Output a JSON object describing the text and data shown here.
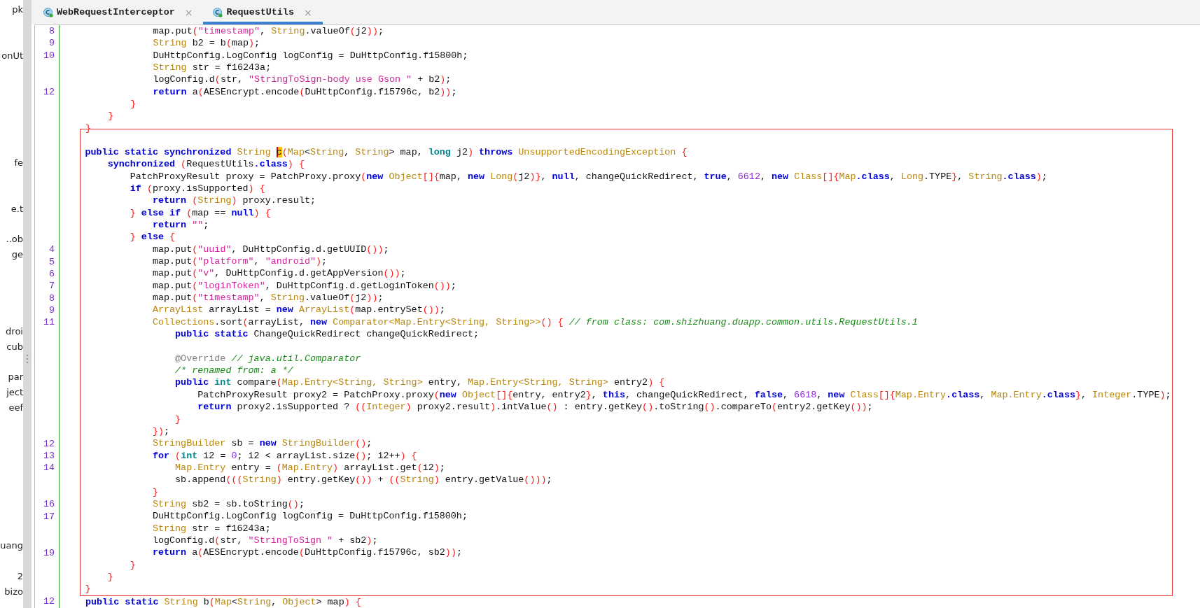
{
  "sidebar": {
    "items": [
      {
        "kind": "label",
        "text": "pk"
      },
      {
        "kind": "gap"
      },
      {
        "kind": "gap"
      },
      {
        "kind": "label",
        "text": "onUt"
      },
      {
        "kind": "gap"
      },
      {
        "kind": "gap"
      },
      {
        "kind": "gap"
      },
      {
        "kind": "gap"
      },
      {
        "kind": "gap"
      },
      {
        "kind": "gap"
      },
      {
        "kind": "label",
        "text": "fe"
      },
      {
        "kind": "gap"
      },
      {
        "kind": "gap"
      },
      {
        "kind": "label",
        "text": "e.t"
      },
      {
        "kind": "gap"
      },
      {
        "kind": "label",
        "text": "..ob"
      },
      {
        "kind": "label",
        "text": "ge"
      },
      {
        "kind": "gap"
      },
      {
        "kind": "gap"
      },
      {
        "kind": "gap"
      },
      {
        "kind": "gap"
      },
      {
        "kind": "label",
        "text": "droi"
      },
      {
        "kind": "label",
        "text": "cub"
      },
      {
        "kind": "gap"
      },
      {
        "kind": "label",
        "text": "par"
      },
      {
        "kind": "label",
        "text": "ject"
      },
      {
        "kind": "label",
        "text": "eef"
      },
      {
        "kind": "gap"
      },
      {
        "kind": "gap"
      },
      {
        "kind": "gap"
      },
      {
        "kind": "gap"
      },
      {
        "kind": "gap"
      },
      {
        "kind": "gap"
      },
      {
        "kind": "gap"
      },
      {
        "kind": "gap"
      },
      {
        "kind": "label",
        "text": "uang"
      },
      {
        "kind": "gap"
      },
      {
        "kind": "label",
        "text": "2"
      },
      {
        "kind": "label",
        "text": "bizo"
      }
    ]
  },
  "tabs": [
    {
      "label": "WebRequestInterceptor",
      "close": "×",
      "selected": false
    },
    {
      "label": "RequestUtils",
      "close": "×",
      "selected": true
    }
  ],
  "editor": {
    "blocks": [
      {
        "framed": false,
        "lines": [
          {
            "kind": "code",
            "number": "8",
            "tokens": [
              {
                "kind": "txt",
                "text": "            map.put"
              },
              {
                "kind": "br",
                "text": "("
              },
              {
                "kind": "str",
                "text": "\"timestamp\""
              },
              {
                "kind": "txt",
                "text": ", "
              },
              {
                "kind": "type",
                "text": "String"
              },
              {
                "kind": "txt",
                "text": ".valueOf"
              },
              {
                "kind": "br",
                "text": "("
              },
              {
                "kind": "txt",
                "text": "j2"
              },
              {
                "kind": "br",
                "text": "))"
              },
              {
                "kind": "txt",
                "text": ";"
              }
            ]
          },
          {
            "kind": "code",
            "number": "9",
            "tokens": [
              {
                "kind": "type",
                "text": "            String"
              },
              {
                "kind": "txt",
                "text": " b2 = b"
              },
              {
                "kind": "br",
                "text": "("
              },
              {
                "kind": "txt",
                "text": "map"
              },
              {
                "kind": "br",
                "text": ")"
              },
              {
                "kind": "txt",
                "text": ";"
              }
            ]
          },
          {
            "kind": "code",
            "number": "10",
            "tokens": [
              {
                "kind": "txt",
                "text": "            DuHttpConfig.LogConfig logConfig = DuHttpConfig.f15800h;"
              }
            ]
          },
          {
            "kind": "code",
            "tokens": [
              {
                "kind": "type",
                "text": "            String"
              },
              {
                "kind": "txt",
                "text": " str = f16243a;"
              }
            ]
          },
          {
            "kind": "code",
            "tokens": [
              {
                "kind": "txt",
                "text": "            logConfig.d"
              },
              {
                "kind": "br",
                "text": "("
              },
              {
                "kind": "txt",
                "text": "str, "
              },
              {
                "kind": "str",
                "text": "\"StringToSign-body use Gson \""
              },
              {
                "kind": "txt",
                "text": " + b2"
              },
              {
                "kind": "br",
                "text": ")"
              },
              {
                "kind": "txt",
                "text": ";"
              }
            ]
          },
          {
            "kind": "code",
            "number": "12",
            "tokens": [
              {
                "kind": "kw",
                "text": "            return"
              },
              {
                "kind": "txt",
                "text": " a"
              },
              {
                "kind": "br",
                "text": "("
              },
              {
                "kind": "txt",
                "text": "AESEncrypt.encode"
              },
              {
                "kind": "br",
                "text": "("
              },
              {
                "kind": "txt",
                "text": "DuHttpConfig.f15796c, b2"
              },
              {
                "kind": "br",
                "text": "))"
              },
              {
                "kind": "txt",
                "text": ";"
              }
            ]
          },
          {
            "kind": "code",
            "tokens": [
              {
                "kind": "br",
                "text": "        }"
              }
            ]
          },
          {
            "kind": "code",
            "tokens": [
              {
                "kind": "br",
                "text": "    }"
              }
            ]
          },
          {
            "kind": "code",
            "tokens": [
              {
                "kind": "br",
                "text": "}"
              }
            ]
          }
        ]
      },
      {
        "framed": true,
        "lines": [
          {
            "kind": "blank"
          },
          {
            "kind": "code",
            "tokens": [
              {
                "kind": "kw",
                "text": "public static synchronized "
              },
              {
                "kind": "type",
                "text": "String "
              },
              {
                "kind": "mark",
                "text": "c"
              },
              {
                "kind": "br",
                "text": "("
              },
              {
                "kind": "type",
                "text": "Map"
              },
              {
                "kind": "txt",
                "text": "<"
              },
              {
                "kind": "type",
                "text": "String"
              },
              {
                "kind": "txt",
                "text": ", "
              },
              {
                "kind": "type",
                "text": "String"
              },
              {
                "kind": "txt",
                "text": "> map, "
              },
              {
                "kind": "prim",
                "text": "long"
              },
              {
                "kind": "txt",
                "text": " j2"
              },
              {
                "kind": "br",
                "text": ") "
              },
              {
                "kind": "kw",
                "text": "throws "
              },
              {
                "kind": "type",
                "text": "UnsupportedEncodingException "
              },
              {
                "kind": "br",
                "text": "{"
              }
            ]
          },
          {
            "kind": "code",
            "tokens": [
              {
                "kind": "kw",
                "text": "    synchronized "
              },
              {
                "kind": "br",
                "text": "("
              },
              {
                "kind": "txt",
                "text": "RequestUtils"
              },
              {
                "kind": "kw",
                "text": ".class"
              },
              {
                "kind": "br",
                "text": ") {"
              }
            ]
          },
          {
            "kind": "code",
            "tokens": [
              {
                "kind": "txt",
                "text": "        PatchProxyResult proxy = PatchProxy.proxy"
              },
              {
                "kind": "br",
                "text": "("
              },
              {
                "kind": "kw",
                "text": "new "
              },
              {
                "kind": "type",
                "text": "Object"
              },
              {
                "kind": "br",
                "text": "[]{"
              },
              {
                "kind": "txt",
                "text": "map, "
              },
              {
                "kind": "kw",
                "text": "new "
              },
              {
                "kind": "type",
                "text": "Long"
              },
              {
                "kind": "br",
                "text": "("
              },
              {
                "kind": "txt",
                "text": "j2"
              },
              {
                "kind": "br",
                "text": ")}"
              },
              {
                "kind": "txt",
                "text": ", "
              },
              {
                "kind": "kw",
                "text": "null"
              },
              {
                "kind": "txt",
                "text": ", changeQuickRedirect, "
              },
              {
                "kind": "kw",
                "text": "true"
              },
              {
                "kind": "txt",
                "text": ", "
              },
              {
                "kind": "num",
                "text": "6612"
              },
              {
                "kind": "txt",
                "text": ", "
              },
              {
                "kind": "kw",
                "text": "new "
              },
              {
                "kind": "type",
                "text": "Class"
              },
              {
                "kind": "br",
                "text": "[]{"
              },
              {
                "kind": "type",
                "text": "Map"
              },
              {
                "kind": "kw",
                "text": ".class"
              },
              {
                "kind": "txt",
                "text": ", "
              },
              {
                "kind": "type",
                "text": "Long"
              },
              {
                "kind": "txt",
                "text": ".TYPE"
              },
              {
                "kind": "br",
                "text": "}"
              },
              {
                "kind": "txt",
                "text": ", "
              },
              {
                "kind": "type",
                "text": "String"
              },
              {
                "kind": "kw",
                "text": ".class"
              },
              {
                "kind": "br",
                "text": ")"
              },
              {
                "kind": "txt",
                "text": ";"
              }
            ]
          },
          {
            "kind": "code",
            "tokens": [
              {
                "kind": "kw",
                "text": "        if "
              },
              {
                "kind": "br",
                "text": "("
              },
              {
                "kind": "txt",
                "text": "proxy.isSupported"
              },
              {
                "kind": "br",
                "text": ") {"
              }
            ]
          },
          {
            "kind": "code",
            "tokens": [
              {
                "kind": "kw",
                "text": "            return "
              },
              {
                "kind": "br",
                "text": "("
              },
              {
                "kind": "type",
                "text": "String"
              },
              {
                "kind": "br",
                "text": ")"
              },
              {
                "kind": "txt",
                "text": " proxy.result;"
              }
            ]
          },
          {
            "kind": "code",
            "tokens": [
              {
                "kind": "br",
                "text": "        } "
              },
              {
                "kind": "kw",
                "text": "else if "
              },
              {
                "kind": "br",
                "text": "("
              },
              {
                "kind": "txt",
                "text": "map == "
              },
              {
                "kind": "kw",
                "text": "null"
              },
              {
                "kind": "br",
                "text": ") {"
              }
            ]
          },
          {
            "kind": "code",
            "tokens": [
              {
                "kind": "kw",
                "text": "            return "
              },
              {
                "kind": "str",
                "text": "\"\""
              },
              {
                "kind": "txt",
                "text": ";"
              }
            ]
          },
          {
            "kind": "code",
            "tokens": [
              {
                "kind": "br",
                "text": "        } "
              },
              {
                "kind": "kw",
                "text": "else "
              },
              {
                "kind": "br",
                "text": "{"
              }
            ]
          },
          {
            "kind": "code",
            "number": "4",
            "tokens": [
              {
                "kind": "txt",
                "text": "            map.put"
              },
              {
                "kind": "br",
                "text": "("
              },
              {
                "kind": "str",
                "text": "\"uuid\""
              },
              {
                "kind": "txt",
                "text": ", DuHttpConfig.d.getUUID"
              },
              {
                "kind": "br",
                "text": "())"
              },
              {
                "kind": "txt",
                "text": ";"
              }
            ]
          },
          {
            "kind": "code",
            "number": "5",
            "tokens": [
              {
                "kind": "txt",
                "text": "            map.put"
              },
              {
                "kind": "br",
                "text": "("
              },
              {
                "kind": "str",
                "text": "\"platform\""
              },
              {
                "kind": "txt",
                "text": ", "
              },
              {
                "kind": "str",
                "text": "\"android\""
              },
              {
                "kind": "br",
                "text": ")"
              },
              {
                "kind": "txt",
                "text": ";"
              }
            ]
          },
          {
            "kind": "code",
            "number": "6",
            "tokens": [
              {
                "kind": "txt",
                "text": "            map.put"
              },
              {
                "kind": "br",
                "text": "("
              },
              {
                "kind": "str",
                "text": "\"v\""
              },
              {
                "kind": "txt",
                "text": ", DuHttpConfig.d.getAppVersion"
              },
              {
                "kind": "br",
                "text": "())"
              },
              {
                "kind": "txt",
                "text": ";"
              }
            ]
          },
          {
            "kind": "code",
            "number": "7",
            "tokens": [
              {
                "kind": "txt",
                "text": "            map.put"
              },
              {
                "kind": "br",
                "text": "("
              },
              {
                "kind": "str",
                "text": "\"loginToken\""
              },
              {
                "kind": "txt",
                "text": ", DuHttpConfig.d.getLoginToken"
              },
              {
                "kind": "br",
                "text": "())"
              },
              {
                "kind": "txt",
                "text": ";"
              }
            ]
          },
          {
            "kind": "code",
            "number": "8",
            "tokens": [
              {
                "kind": "txt",
                "text": "            map.put"
              },
              {
                "kind": "br",
                "text": "("
              },
              {
                "kind": "str",
                "text": "\"timestamp\""
              },
              {
                "kind": "txt",
                "text": ", "
              },
              {
                "kind": "type",
                "text": "String"
              },
              {
                "kind": "txt",
                "text": ".valueOf"
              },
              {
                "kind": "br",
                "text": "("
              },
              {
                "kind": "txt",
                "text": "j2"
              },
              {
                "kind": "br",
                "text": "))"
              },
              {
                "kind": "txt",
                "text": ";"
              }
            ]
          },
          {
            "kind": "code",
            "number": "9",
            "tokens": [
              {
                "kind": "type",
                "text": "            ArrayList"
              },
              {
                "kind": "txt",
                "text": " arrayList = "
              },
              {
                "kind": "kw",
                "text": "new "
              },
              {
                "kind": "type",
                "text": "ArrayList"
              },
              {
                "kind": "br",
                "text": "("
              },
              {
                "kind": "txt",
                "text": "map.entrySet"
              },
              {
                "kind": "br",
                "text": "())"
              },
              {
                "kind": "txt",
                "text": ";"
              }
            ]
          },
          {
            "kind": "code",
            "number": "11",
            "tokens": [
              {
                "kind": "type",
                "text": "            Collections"
              },
              {
                "kind": "txt",
                "text": ".sort"
              },
              {
                "kind": "br",
                "text": "("
              },
              {
                "kind": "txt",
                "text": "arrayList, "
              },
              {
                "kind": "kw",
                "text": "new "
              },
              {
                "kind": "type",
                "text": "Comparator<Map.Entry<String, String>>"
              },
              {
                "kind": "br",
                "text": "() { "
              },
              {
                "kind": "com",
                "text": "// from class: com.shizhuang.duapp.common.utils.RequestUtils.1"
              }
            ]
          },
          {
            "kind": "code",
            "tokens": [
              {
                "kind": "kw",
                "text": "                public static"
              },
              {
                "kind": "txt",
                "text": " ChangeQuickRedirect changeQuickRedirect;"
              }
            ]
          },
          {
            "kind": "blank"
          },
          {
            "kind": "code",
            "tokens": [
              {
                "kind": "ann",
                "text": "                @Override "
              },
              {
                "kind": "com",
                "text": "// java.util.Comparator"
              }
            ]
          },
          {
            "kind": "code",
            "tokens": [
              {
                "kind": "com",
                "text": "                /* renamed from: a */"
              }
            ]
          },
          {
            "kind": "code",
            "tokens": [
              {
                "kind": "kw",
                "text": "                public "
              },
              {
                "kind": "prim",
                "text": "int"
              },
              {
                "kind": "txt",
                "text": " compare"
              },
              {
                "kind": "br",
                "text": "("
              },
              {
                "kind": "type",
                "text": "Map.Entry<String, String>"
              },
              {
                "kind": "txt",
                "text": " entry, "
              },
              {
                "kind": "type",
                "text": "Map.Entry<String, String>"
              },
              {
                "kind": "txt",
                "text": " entry2"
              },
              {
                "kind": "br",
                "text": ") {"
              }
            ]
          },
          {
            "kind": "code",
            "tokens": [
              {
                "kind": "txt",
                "text": "                    PatchProxyResult proxy2 = PatchProxy.proxy"
              },
              {
                "kind": "br",
                "text": "("
              },
              {
                "kind": "kw",
                "text": "new "
              },
              {
                "kind": "type",
                "text": "Object"
              },
              {
                "kind": "br",
                "text": "[]{"
              },
              {
                "kind": "txt",
                "text": "entry, entry2"
              },
              {
                "kind": "br",
                "text": "}"
              },
              {
                "kind": "txt",
                "text": ", "
              },
              {
                "kind": "kw",
                "text": "this"
              },
              {
                "kind": "txt",
                "text": ", changeQuickRedirect, "
              },
              {
                "kind": "kw",
                "text": "false"
              },
              {
                "kind": "txt",
                "text": ", "
              },
              {
                "kind": "num",
                "text": "6618"
              },
              {
                "kind": "txt",
                "text": ", "
              },
              {
                "kind": "kw",
                "text": "new "
              },
              {
                "kind": "type",
                "text": "Class"
              },
              {
                "kind": "br",
                "text": "[]{"
              },
              {
                "kind": "type",
                "text": "Map.Entry"
              },
              {
                "kind": "kw",
                "text": ".class"
              },
              {
                "kind": "txt",
                "text": ", "
              },
              {
                "kind": "type",
                "text": "Map.Entry"
              },
              {
                "kind": "kw",
                "text": ".class"
              },
              {
                "kind": "br",
                "text": "}"
              },
              {
                "kind": "txt",
                "text": ", "
              },
              {
                "kind": "type",
                "text": "Integer"
              },
              {
                "kind": "txt",
                "text": ".TYPE"
              },
              {
                "kind": "br",
                "text": ")"
              },
              {
                "kind": "txt",
                "text": ";"
              }
            ]
          },
          {
            "kind": "code",
            "tokens": [
              {
                "kind": "kw",
                "text": "                    return"
              },
              {
                "kind": "txt",
                "text": " proxy2.isSupported ? "
              },
              {
                "kind": "br",
                "text": "(("
              },
              {
                "kind": "type",
                "text": "Integer"
              },
              {
                "kind": "br",
                "text": ")"
              },
              {
                "kind": "txt",
                "text": " proxy2.result"
              },
              {
                "kind": "br",
                "text": ")"
              },
              {
                "kind": "txt",
                "text": ".intValue"
              },
              {
                "kind": "br",
                "text": "()"
              },
              {
                "kind": "txt",
                "text": " : entry.getKey"
              },
              {
                "kind": "br",
                "text": "()"
              },
              {
                "kind": "txt",
                "text": ".toString"
              },
              {
                "kind": "br",
                "text": "()"
              },
              {
                "kind": "txt",
                "text": ".compareTo"
              },
              {
                "kind": "br",
                "text": "("
              },
              {
                "kind": "txt",
                "text": "entry2.getKey"
              },
              {
                "kind": "br",
                "text": "())"
              },
              {
                "kind": "txt",
                "text": ";"
              }
            ]
          },
          {
            "kind": "code",
            "tokens": [
              {
                "kind": "br",
                "text": "                }"
              }
            ]
          },
          {
            "kind": "code",
            "tokens": [
              {
                "kind": "br",
                "text": "            })"
              },
              {
                "kind": "txt",
                "text": ";"
              }
            ]
          },
          {
            "kind": "code",
            "number": "12",
            "tokens": [
              {
                "kind": "type",
                "text": "            StringBuilder"
              },
              {
                "kind": "txt",
                "text": " sb = "
              },
              {
                "kind": "kw",
                "text": "new "
              },
              {
                "kind": "type",
                "text": "StringBuilder"
              },
              {
                "kind": "br",
                "text": "()"
              },
              {
                "kind": "txt",
                "text": ";"
              }
            ]
          },
          {
            "kind": "code",
            "number": "13",
            "tokens": [
              {
                "kind": "kw",
                "text": "            for "
              },
              {
                "kind": "br",
                "text": "("
              },
              {
                "kind": "prim",
                "text": "int"
              },
              {
                "kind": "txt",
                "text": " i2 = "
              },
              {
                "kind": "num",
                "text": "0"
              },
              {
                "kind": "txt",
                "text": "; i2 < arrayList.size"
              },
              {
                "kind": "br",
                "text": "()"
              },
              {
                "kind": "txt",
                "text": "; i2++"
              },
              {
                "kind": "br",
                "text": ") {"
              }
            ]
          },
          {
            "kind": "code",
            "number": "14",
            "tokens": [
              {
                "kind": "type",
                "text": "                Map.Entry"
              },
              {
                "kind": "txt",
                "text": " entry = "
              },
              {
                "kind": "br",
                "text": "("
              },
              {
                "kind": "type",
                "text": "Map.Entry"
              },
              {
                "kind": "br",
                "text": ")"
              },
              {
                "kind": "txt",
                "text": " arrayList.get"
              },
              {
                "kind": "br",
                "text": "("
              },
              {
                "kind": "txt",
                "text": "i2"
              },
              {
                "kind": "br",
                "text": ")"
              },
              {
                "kind": "txt",
                "text": ";"
              }
            ]
          },
          {
            "kind": "code",
            "tokens": [
              {
                "kind": "txt",
                "text": "                sb.append"
              },
              {
                "kind": "br",
                "text": "((("
              },
              {
                "kind": "type",
                "text": "String"
              },
              {
                "kind": "br",
                "text": ")"
              },
              {
                "kind": "txt",
                "text": " entry.getKey"
              },
              {
                "kind": "br",
                "text": "())"
              },
              {
                "kind": "txt",
                "text": " + "
              },
              {
                "kind": "br",
                "text": "(("
              },
              {
                "kind": "type",
                "text": "String"
              },
              {
                "kind": "br",
                "text": ")"
              },
              {
                "kind": "txt",
                "text": " entry.getValue"
              },
              {
                "kind": "br",
                "text": "()))"
              },
              {
                "kind": "txt",
                "text": ";"
              }
            ]
          },
          {
            "kind": "code",
            "tokens": [
              {
                "kind": "br",
                "text": "            }"
              }
            ]
          },
          {
            "kind": "code",
            "number": "16",
            "tokens": [
              {
                "kind": "type",
                "text": "            String"
              },
              {
                "kind": "txt",
                "text": " sb2 = sb.toString"
              },
              {
                "kind": "br",
                "text": "()"
              },
              {
                "kind": "txt",
                "text": ";"
              }
            ]
          },
          {
            "kind": "code",
            "number": "17",
            "tokens": [
              {
                "kind": "txt",
                "text": "            DuHttpConfig.LogConfig logConfig = DuHttpConfig.f15800h;"
              }
            ]
          },
          {
            "kind": "code",
            "tokens": [
              {
                "kind": "type",
                "text": "            String"
              },
              {
                "kind": "txt",
                "text": " str = f16243a;"
              }
            ]
          },
          {
            "kind": "code",
            "tokens": [
              {
                "kind": "txt",
                "text": "            logConfig.d"
              },
              {
                "kind": "br",
                "text": "("
              },
              {
                "kind": "txt",
                "text": "str, "
              },
              {
                "kind": "str",
                "text": "\"StringToSign \""
              },
              {
                "kind": "txt",
                "text": " + sb2"
              },
              {
                "kind": "br",
                "text": ")"
              },
              {
                "kind": "txt",
                "text": ";"
              }
            ]
          },
          {
            "kind": "code",
            "number": "19",
            "tokens": [
              {
                "kind": "kw",
                "text": "            return"
              },
              {
                "kind": "txt",
                "text": " a"
              },
              {
                "kind": "br",
                "text": "("
              },
              {
                "kind": "txt",
                "text": "AESEncrypt.encode"
              },
              {
                "kind": "br",
                "text": "("
              },
              {
                "kind": "txt",
                "text": "DuHttpConfig.f15796c, sb2"
              },
              {
                "kind": "br",
                "text": "))"
              },
              {
                "kind": "txt",
                "text": ";"
              }
            ]
          },
          {
            "kind": "code",
            "tokens": [
              {
                "kind": "br",
                "text": "        }"
              }
            ]
          },
          {
            "kind": "code",
            "tokens": [
              {
                "kind": "br",
                "text": "    }"
              }
            ]
          },
          {
            "kind": "code",
            "tokens": [
              {
                "kind": "br",
                "text": "}"
              }
            ]
          }
        ]
      },
      {
        "framed": false,
        "lines": [
          {
            "kind": "code",
            "number": "12",
            "tokens": [
              {
                "kind": "kw",
                "text": "public static "
              },
              {
                "kind": "type",
                "text": "String"
              },
              {
                "kind": "txt",
                "text": " b"
              },
              {
                "kind": "br",
                "text": "("
              },
              {
                "kind": "type",
                "text": "Map"
              },
              {
                "kind": "txt",
                "text": "<"
              },
              {
                "kind": "type",
                "text": "String"
              },
              {
                "kind": "txt",
                "text": ", "
              },
              {
                "kind": "type",
                "text": "Object"
              },
              {
                "kind": "txt",
                "text": "> map"
              },
              {
                "kind": "br",
                "text": ") {"
              }
            ]
          }
        ]
      }
    ]
  }
}
